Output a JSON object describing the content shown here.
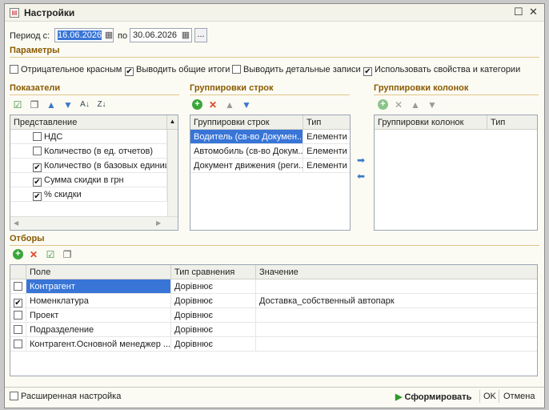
{
  "window": {
    "title": "Настройки",
    "maximize": "☐",
    "close": "✕"
  },
  "period": {
    "label": "Период с:",
    "from": "16.06.2026",
    "to_label": "по",
    "to": "30.06.2026",
    "dots": "..."
  },
  "params": {
    "title": "Параметры",
    "items": [
      {
        "label": "Отрицательное красным",
        "checked": false
      },
      {
        "label": "Выводить общие итоги",
        "checked": true
      },
      {
        "label": "Выводить детальные записи",
        "checked": false
      },
      {
        "label": "Использовать свойства и категории",
        "checked": true
      }
    ]
  },
  "indicators": {
    "title": "Показатели",
    "column": "Представление",
    "rows": [
      {
        "label": "НДС",
        "checked": false
      },
      {
        "label": "Количество (в ед. отчетов)",
        "checked": false
      },
      {
        "label": "Количество (в базовых единиц",
        "checked": true
      },
      {
        "label": "Сумма скидки в грн",
        "checked": true
      },
      {
        "label": "% скидки",
        "checked": true
      }
    ]
  },
  "row_groups": {
    "title": "Группировки строк",
    "columns": [
      "Группировки строк",
      "Тип"
    ],
    "rows": [
      {
        "name": "Водитель (св-во Докумен...",
        "type": "Елементи"
      },
      {
        "name": "Автомобиль (св-во Докум...",
        "type": "Елементи"
      },
      {
        "name": "Документ движения (реги...",
        "type": "Елементи"
      }
    ]
  },
  "col_groups": {
    "title": "Группировки колонок",
    "columns": [
      "Группировки колонок",
      "Тип"
    ]
  },
  "filters": {
    "title": "Отборы",
    "columns": [
      "Поле",
      "Тип сравнения",
      "Значение"
    ],
    "rows": [
      {
        "checked": false,
        "field": "Контрагент",
        "compare": "Дорівнює",
        "value": ""
      },
      {
        "checked": true,
        "field": "Номенклатура",
        "compare": "Дорівнює",
        "value": "Доставка_собственный автопарк"
      },
      {
        "checked": false,
        "field": "Проект",
        "compare": "Дорівнює",
        "value": ""
      },
      {
        "checked": false,
        "field": "Подразделение",
        "compare": "Дорівнює",
        "value": ""
      },
      {
        "checked": false,
        "field": "Контрагент.Основной менеджер ...",
        "compare": "Дорівнює",
        "value": ""
      }
    ]
  },
  "footer": {
    "extended": "Расширенная настройка",
    "generate": "Сформировать",
    "ok": "OK",
    "cancel": "Отмена"
  }
}
